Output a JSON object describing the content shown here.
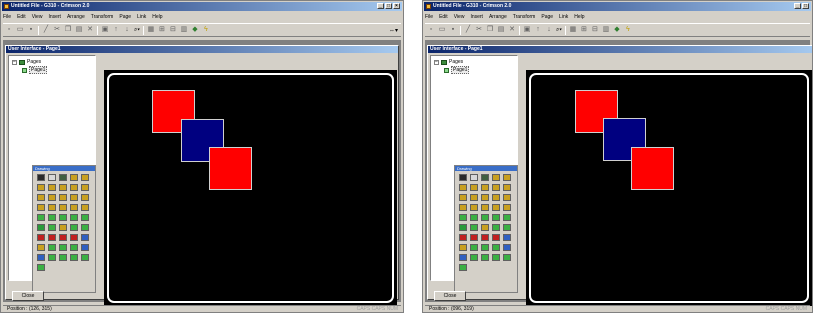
{
  "left": {
    "app_title": "Untitled File - G310 - Crimson 2.0",
    "position": "Position : (126, 315)",
    "squares": [
      {
        "name": "red-square-top",
        "color": "#ff0000"
      },
      {
        "name": "blue-square",
        "color": "#000080"
      },
      {
        "name": "red-square-bottom",
        "color": "#ff0000"
      }
    ]
  },
  "right": {
    "app_title": "Untitled File - G310 - Crimson 2.0",
    "position": "Position : (096, 319)",
    "squares": [
      {
        "name": "red-square-top",
        "color": "#ff0000"
      },
      {
        "name": "blue-square",
        "color": "#000080"
      },
      {
        "name": "red-square-bottom",
        "color": "#ff0000"
      }
    ]
  },
  "menu": [
    "File",
    "Edit",
    "View",
    "Insert",
    "Arrange",
    "Transform",
    "Page",
    "Link",
    "Help"
  ],
  "window_title": "User Interface - Page1",
  "tree": {
    "root": "Pages",
    "child": "Page1"
  },
  "palette": {
    "title": "Drawing",
    "colors": [
      "#2a2a2a",
      "#d8d8d8",
      "#406040",
      "#c8a020",
      "#c8a020",
      "#c8a020",
      "#c8a020",
      "#c8a020",
      "#c8a020",
      "#c8a020",
      "#c8a020",
      "#c8a020",
      "#c8a020",
      "#c8a020",
      "#c8a020",
      "#c8a020",
      "#c8a020",
      "#c8a020",
      "#c8a020",
      "#c8a020",
      "#3cb043",
      "#3cb043",
      "#3cb043",
      "#3cb043",
      "#3cb043",
      "#2a9a3a",
      "#3cb043",
      "#c8a020",
      "#3cb043",
      "#3cb043",
      "#c02020",
      "#c02020",
      "#c02020",
      "#c02020",
      "#3060c0",
      "#c8a020",
      "#3cb043",
      "#3cb043",
      "#3cb043",
      "#3060c0",
      "#3060c0",
      "#3cb043",
      "#3cb043",
      "#3cb043",
      "#3cb043",
      "#3cb043"
    ]
  },
  "close_label": "Close",
  "indicators": "CAPS CAPS NUM"
}
